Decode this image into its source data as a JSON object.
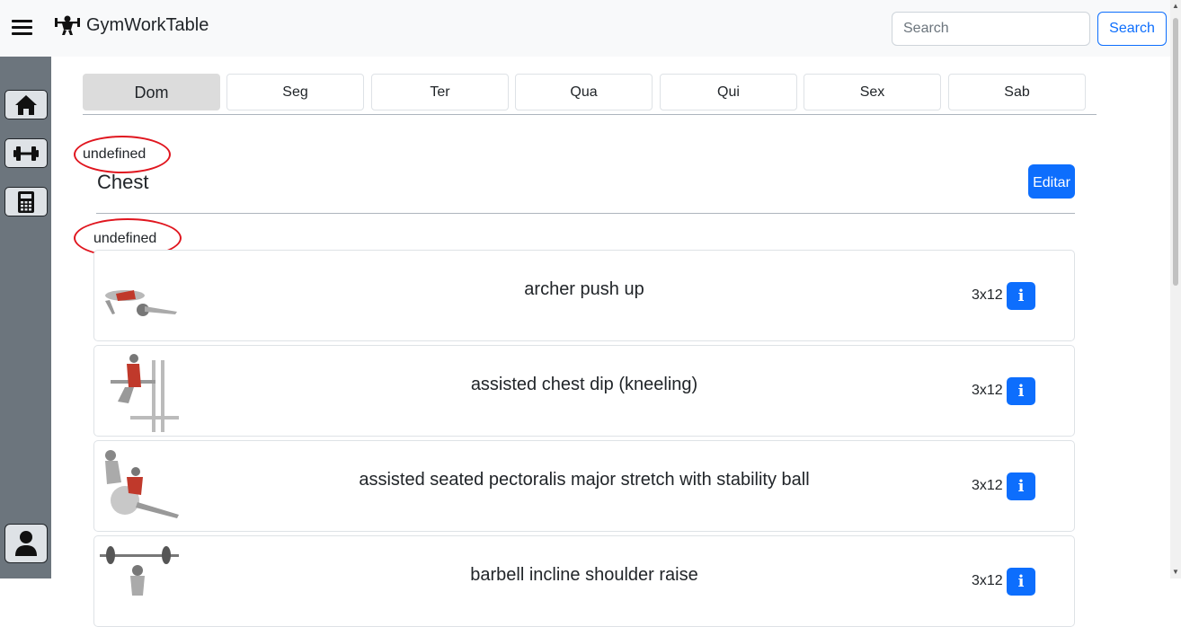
{
  "app": {
    "name": "GymWorkTable"
  },
  "search": {
    "placeholder": "Search",
    "button_label": "Search"
  },
  "days": [
    "Dom",
    "Seg",
    "Ter",
    "Qua",
    "Qui",
    "Sex",
    "Sab"
  ],
  "active_day": "Dom",
  "group": {
    "day_label": "undefined",
    "title": "Chest",
    "edit_label": "Editar",
    "section_label": "undefined"
  },
  "exercises": [
    {
      "name": "archer push up",
      "sets": "3x12"
    },
    {
      "name": "assisted chest dip (kneeling)",
      "sets": "3x12"
    },
    {
      "name": "assisted seated pectoralis major stretch with stability ball",
      "sets": "3x12"
    },
    {
      "name": "barbell incline shoulder raise",
      "sets": "3x12"
    }
  ],
  "info_label": "i",
  "colors": {
    "primary": "#0d6efd",
    "sidebar": "#6c757d",
    "navbar": "#f8f9fa",
    "annotation": "#e0161f"
  },
  "icons": [
    "menu-icon",
    "brand-logo-icon",
    "home-icon",
    "dumbbell-icon",
    "calculator-icon",
    "user-icon",
    "info-icon"
  ]
}
